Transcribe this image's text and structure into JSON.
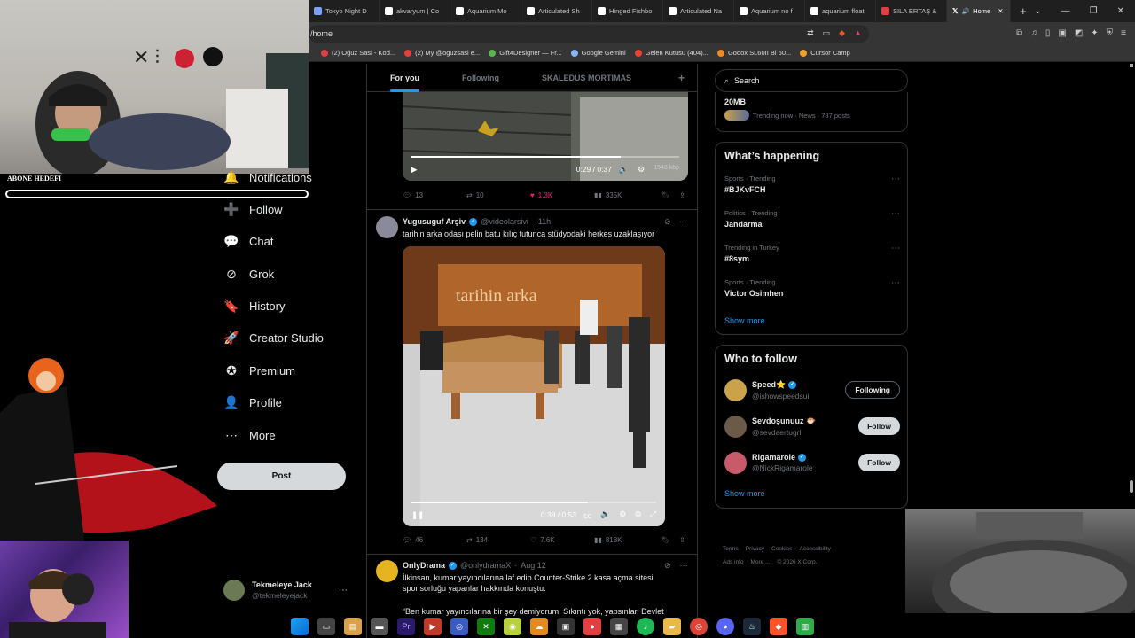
{
  "browser": {
    "tabs": [
      {
        "label": "Tokyo Night D",
        "color": "#7aa2f7"
      },
      {
        "label": "akvaryum | Co",
        "color": "#ffffff"
      },
      {
        "label": "Aquarium Mo",
        "color": "#ffffff"
      },
      {
        "label": "Articulated Sh",
        "color": "#ffffff"
      },
      {
        "label": "Hinged Fishbo",
        "color": "#ffffff"
      },
      {
        "label": "Articulated Na",
        "color": "#ffffff"
      },
      {
        "label": "Aquarium no f",
        "color": "#ffffff"
      },
      {
        "label": "aquarium float",
        "color": "#ffffff"
      },
      {
        "label": "SILA ERTAŞ & ",
        "color": "#e04040"
      }
    ],
    "active_tab": "Home",
    "url": "/home",
    "bookmarks": [
      {
        "label": "(2) Oğuz Sasi - Kod...",
        "color": "#e04040"
      },
      {
        "label": "(2) My @oguzsasi e...",
        "color": "#e04040"
      },
      {
        "label": "Gift4Designer — Fr...",
        "color": "#5ab552"
      },
      {
        "label": "Google Gemini",
        "color": "#8ab4f8"
      },
      {
        "label": "Gelen Kutusu (404)...",
        "color": "#ea4335"
      },
      {
        "label": "Godox SL60II Bi 60...",
        "color": "#f08a24"
      },
      {
        "label": "Cursor Camp",
        "color": "#f0a030"
      }
    ]
  },
  "overlay": {
    "goal_label": "ABONE HEDEFI"
  },
  "nav": {
    "items": [
      {
        "label": "Notifications",
        "icon": "bell-icon",
        "glyph": "🔔"
      },
      {
        "label": "Follow",
        "icon": "add-person-icon",
        "glyph": "➕"
      },
      {
        "label": "Chat",
        "icon": "chat-icon",
        "glyph": "💬"
      },
      {
        "label": "Grok",
        "icon": "grok-icon",
        "glyph": "⊘"
      },
      {
        "label": "History",
        "icon": "bookmark-icon",
        "glyph": "🔖"
      },
      {
        "label": "Creator Studio",
        "icon": "rocket-icon",
        "glyph": "🚀"
      },
      {
        "label": "Premium",
        "icon": "verified-badge-icon",
        "glyph": "✪"
      },
      {
        "label": "Profile",
        "icon": "person-icon",
        "glyph": "👤"
      },
      {
        "label": "More",
        "icon": "more-circle-icon",
        "glyph": "⋯"
      }
    ],
    "post_label": "Post",
    "account": {
      "name": "Tekmeleye Jack",
      "handle": "@tekmeleyejack"
    }
  },
  "timeline": {
    "tabs": [
      "For you",
      "Following",
      "SKALEDUS MORTIMAS"
    ],
    "add_tab": "+",
    "tweet1": {
      "video_time": "0:29 / 0:37",
      "quality": "1548 kbp",
      "progress": 0.78,
      "replies": "13",
      "reposts": "10",
      "likes": "1.3K",
      "views": "335K"
    },
    "tweet2": {
      "name": "Yugusuguf Arşiv",
      "handle": "@videolarsivi",
      "time": "11h",
      "text": "tarihin arka odası pelin batu kılıç tutunca stüdyodaki herkes uzaklaşıyor",
      "video_time": "0:38 / 0:53",
      "progress": 0.72,
      "replies": "46",
      "reposts": "134",
      "likes": "7.6K",
      "views": "818K"
    },
    "tweet3": {
      "name": "OnlyDrama",
      "handle": "@onlydramaX",
      "time": "Aug 12",
      "text": "İlkinsan, kumar yayıncılarına laf edip Counter-Strike 2 kasa açma sitesi sponsorluğu yapanlar hakkında konuştu.",
      "quote": "“Ben kumar yayıncılarına bir şey demiyorum. Sıkıntı yok, yapsınlar. Devlet"
    }
  },
  "right": {
    "search_placeholder": "Search",
    "prev_trend": {
      "topic": "20MB",
      "meta": "Trending now · News · 787 posts"
    },
    "happening": {
      "title": "What’s happening",
      "trends": [
        {
          "meta": "Sports · Trending",
          "topic": "#BJKvFCH"
        },
        {
          "meta": "Politics · Trending",
          "topic": "Jandarma"
        },
        {
          "meta": "Trending in Turkey",
          "topic": "#8sym"
        },
        {
          "meta": "Sports · Trending",
          "topic": "Victor Osimhen"
        }
      ],
      "show_more": "Show more"
    },
    "who_to_follow": {
      "title": "Who to follow",
      "users": [
        {
          "name": "Speed⭐",
          "handle": "@ishowspeedsui",
          "button": "Following",
          "color": "#c9a24a"
        },
        {
          "name": "Sevdoşunuuz 🐡",
          "handle": "@sevdaertugrl",
          "button": "Follow",
          "color": "#6b5a48"
        },
        {
          "name": "Rigamarole",
          "handle": "@NickRigamarole",
          "button": "Follow",
          "color": "#c85a6a"
        }
      ],
      "show_more": "Show more"
    },
    "footer": [
      "Terms",
      "Privacy",
      "Cookies",
      "Accessibility",
      "Ads info",
      "More ...",
      "© 2026 X Corp."
    ]
  },
  "colors": {
    "accent": "#1d9bf0",
    "like": "#f91880"
  }
}
